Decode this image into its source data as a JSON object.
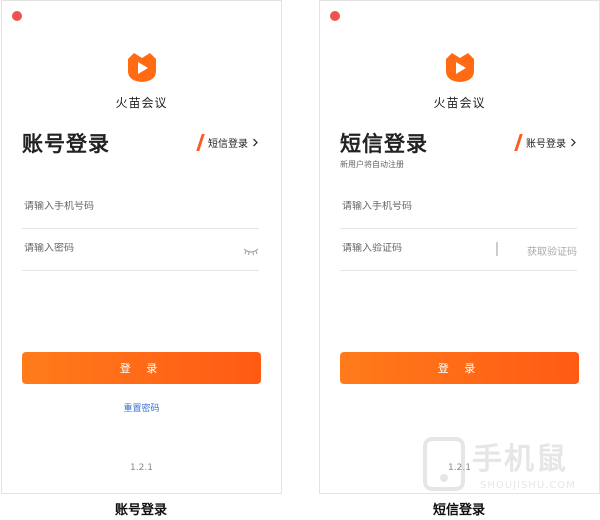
{
  "left_panel": {
    "app_name": "火苗会议",
    "title": "账号登录",
    "switch_label": "短信登录",
    "phone_placeholder": "请输入手机号码",
    "password_placeholder": "请输入密码",
    "submit_label": "登 录",
    "reset_link": "重置密码",
    "version": "1.2.1",
    "caption": "账号登录"
  },
  "right_panel": {
    "app_name": "火苗会议",
    "title": "短信登录",
    "subtitle": "新用户将自动注册",
    "switch_label": "账号登录",
    "phone_placeholder": "请输入手机号码",
    "code_placeholder": "请输入验证码",
    "get_code_label": "获取验证码",
    "submit_label": "登 录",
    "version": "1.2.1",
    "caption": "短信登录"
  },
  "watermark": {
    "text": "手机鼠",
    "sub": "SHOUJISHU.COM"
  },
  "colors": {
    "accent": "#ff5a1f",
    "button_start": "#ff7b1a",
    "button_end": "#ff5a14",
    "link": "#3b6fd4",
    "close_dot": "#ee5350"
  },
  "icons": {
    "close": "close-dot-icon",
    "logo": "flame-play-logo-icon",
    "chevron": "chevron-right-icon",
    "eye": "eye-closed-icon"
  }
}
